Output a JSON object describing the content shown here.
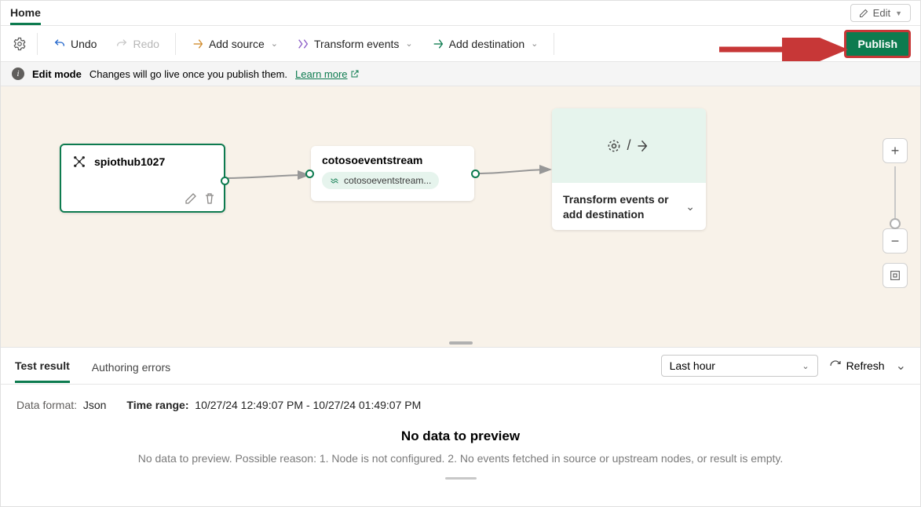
{
  "tabs": {
    "home": "Home"
  },
  "edit_menu": {
    "label": "Edit"
  },
  "toolbar": {
    "undo": "Undo",
    "redo": "Redo",
    "add_source": "Add source",
    "transform": "Transform events",
    "add_dest": "Add destination",
    "publish": "Publish"
  },
  "info": {
    "mode": "Edit mode",
    "msg": "Changes will go live once you publish them.",
    "link": "Learn more"
  },
  "nodes": {
    "source": {
      "title": "spiothub1027"
    },
    "stream": {
      "title": "cotosoeventstream",
      "chip": "cotosoeventstream..."
    },
    "dest": {
      "label": "Transform events or add destination"
    }
  },
  "result_tabs": {
    "test": "Test result",
    "errors": "Authoring errors"
  },
  "time_filter": {
    "selected": "Last hour"
  },
  "refresh": {
    "label": "Refresh"
  },
  "meta": {
    "format_label": "Data format:",
    "format_value": "Json",
    "range_label": "Time range:",
    "range_value": "10/27/24 12:49:07 PM - 10/27/24 01:49:07 PM"
  },
  "empty": {
    "title": "No data to preview",
    "reason": "No data to preview. Possible reason: 1. Node is not configured. 2. No events fetched in source or upstream nodes, or result is empty."
  }
}
